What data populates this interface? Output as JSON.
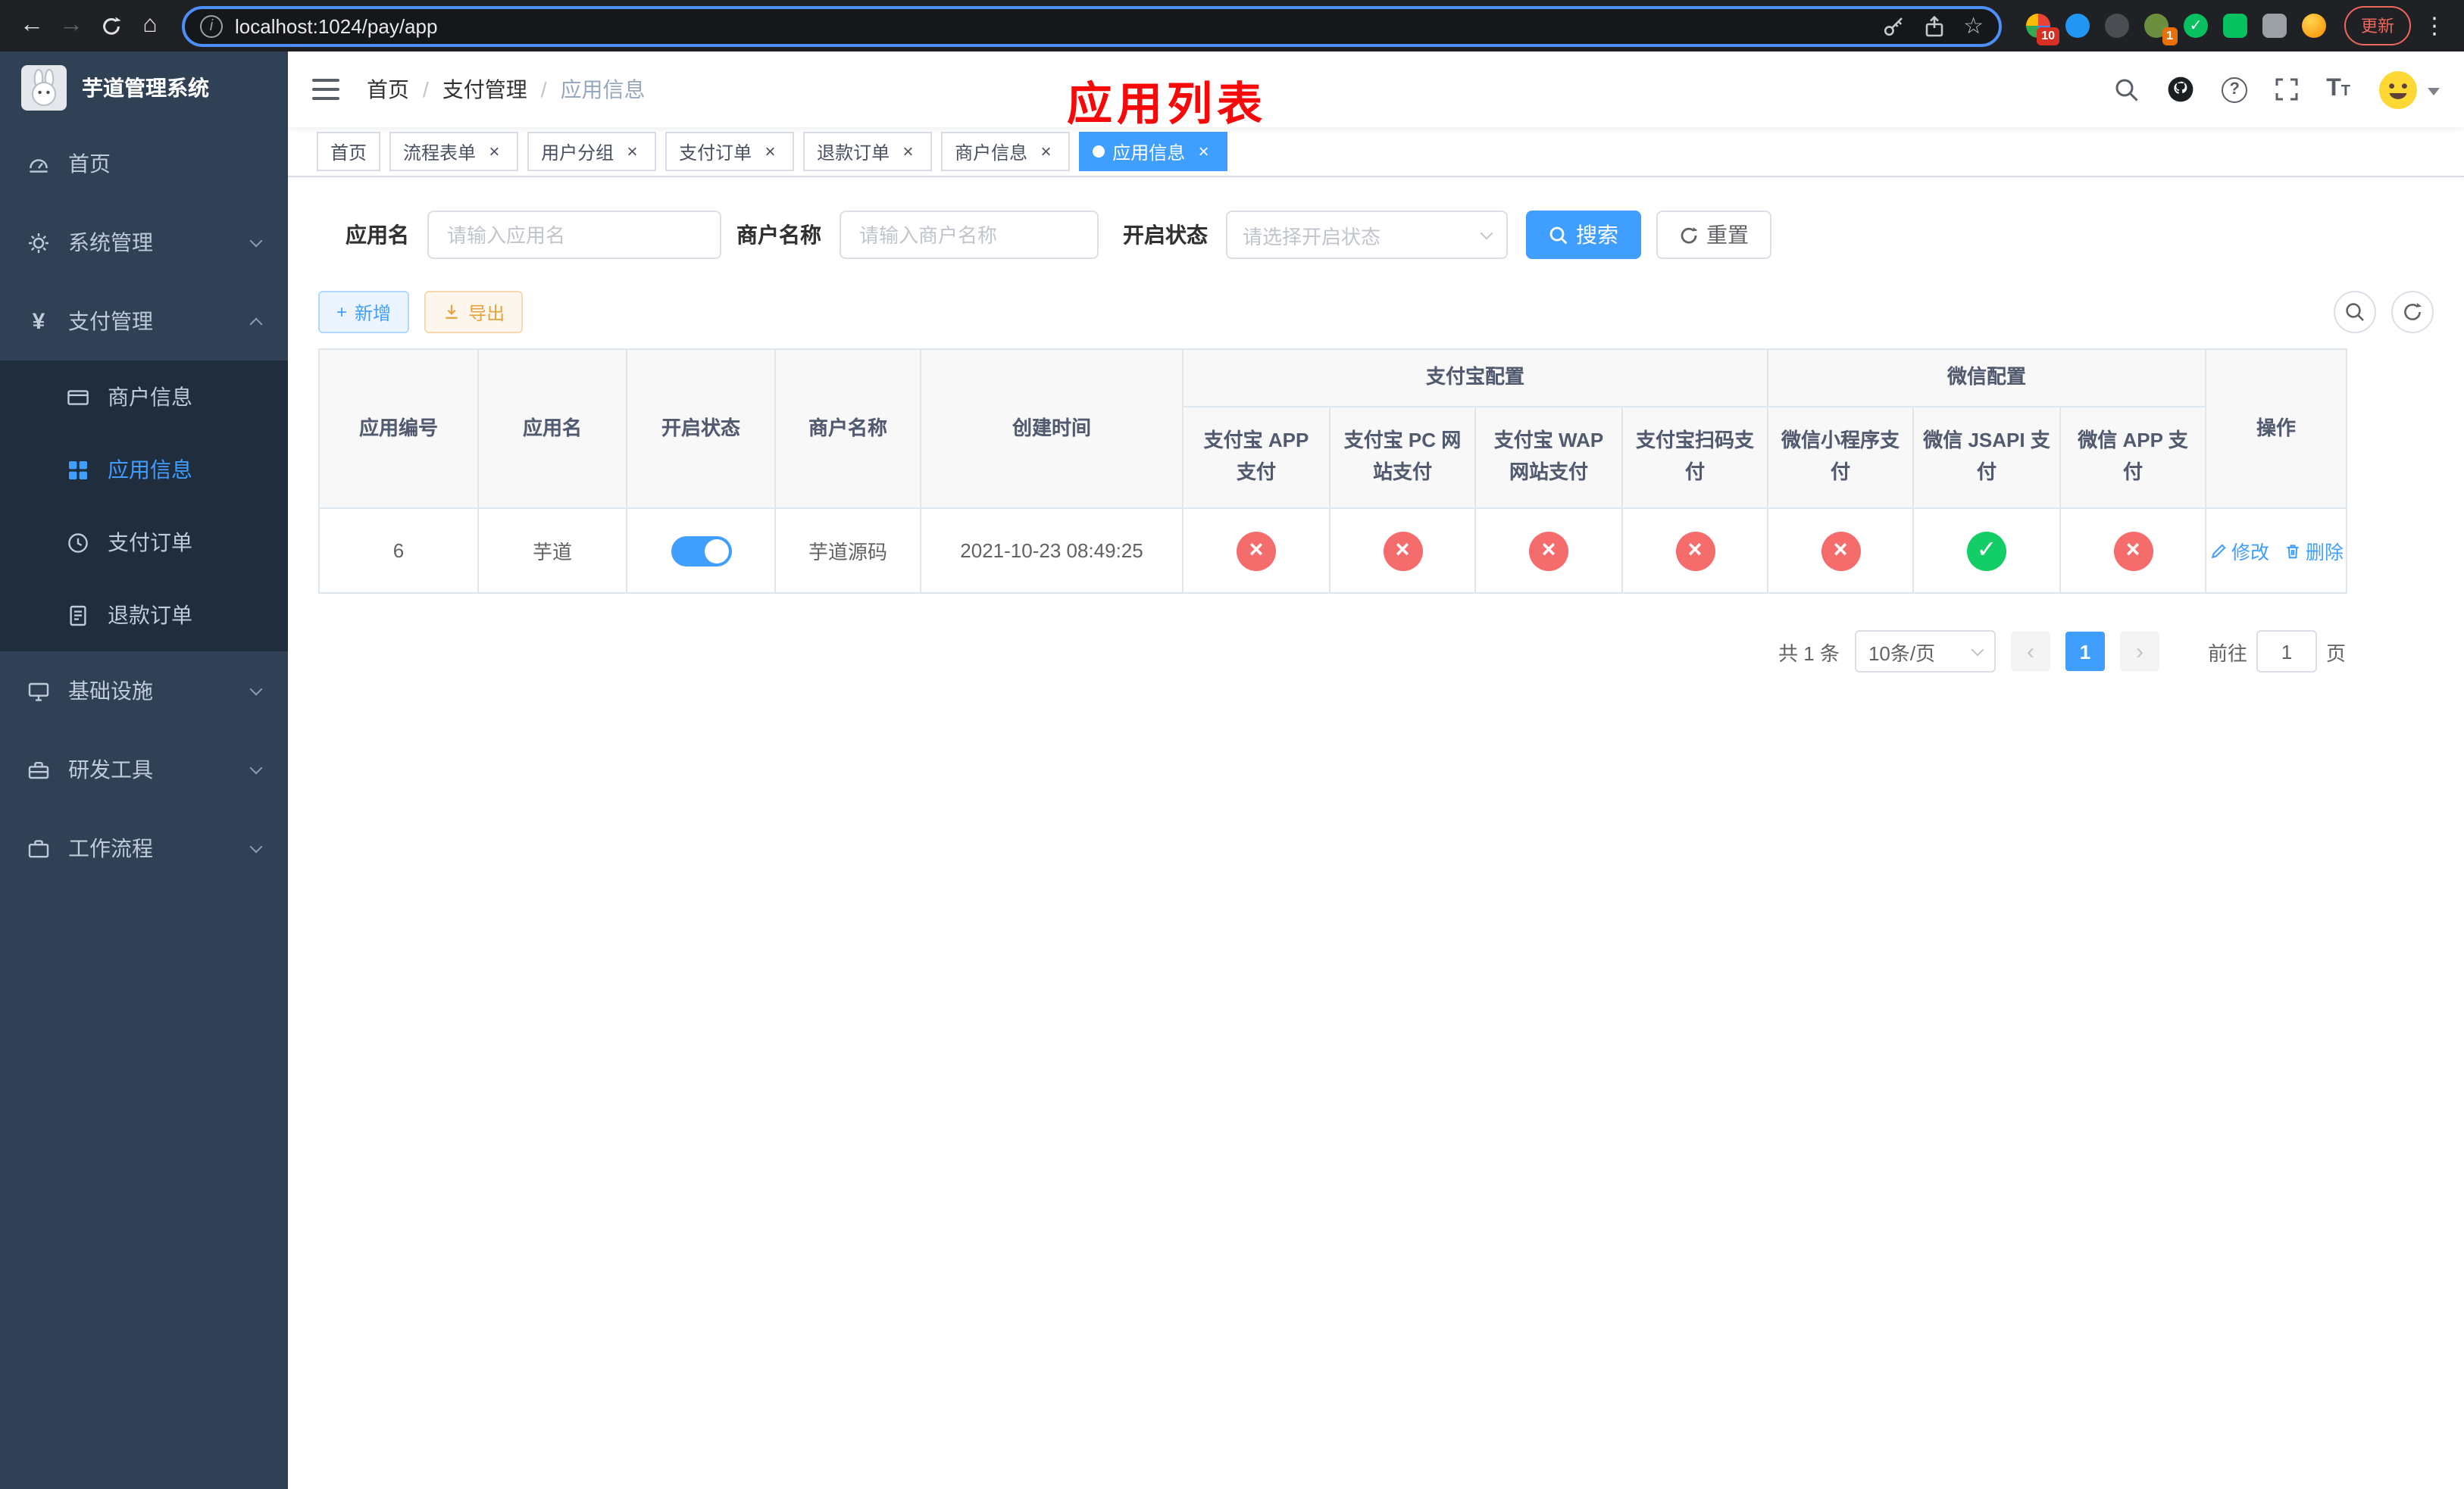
{
  "browser": {
    "url": "localhost:1024/pay/app",
    "update_label": "更新",
    "ext_badge_count": "10",
    "avatar_badge_count": "1"
  },
  "icons": {
    "back": "←",
    "forward": "→",
    "home": "⌂",
    "info": "i",
    "star": "☆",
    "menu_dots": "⋮",
    "question": "?",
    "text_size": "T",
    "close": "×",
    "check": "✓",
    "cross": "×",
    "plus": "+",
    "prev": "‹",
    "next": "›",
    "yen": "¥"
  },
  "sidebar": {
    "title": "芋道管理系统",
    "items": [
      {
        "label": "首页"
      },
      {
        "label": "系统管理"
      },
      {
        "label": "支付管理",
        "expanded": true,
        "children": [
          {
            "label": "商户信息"
          },
          {
            "label": "应用信息",
            "active": true
          },
          {
            "label": "支付订单"
          },
          {
            "label": "退款订单"
          }
        ]
      },
      {
        "label": "基础设施"
      },
      {
        "label": "研发工具"
      },
      {
        "label": "工作流程"
      }
    ]
  },
  "header": {
    "breadcrumb": [
      "首页",
      "支付管理",
      "应用信息"
    ],
    "breadcrumb_separator": "/",
    "overlay_title": "应用列表"
  },
  "tabs": [
    {
      "label": "首页",
      "closable": false
    },
    {
      "label": "流程表单",
      "closable": true
    },
    {
      "label": "用户分组",
      "closable": true
    },
    {
      "label": "支付订单",
      "closable": true
    },
    {
      "label": "退款订单",
      "closable": true
    },
    {
      "label": "商户信息",
      "closable": true
    },
    {
      "label": "应用信息",
      "closable": true,
      "active": true
    }
  ],
  "filters": {
    "app_name_label": "应用名",
    "app_name_placeholder": "请输入应用名",
    "merchant_label": "商户名称",
    "merchant_placeholder": "请输入商户名称",
    "status_label": "开启状态",
    "status_placeholder": "请选择开启状态",
    "search_button": "搜索",
    "reset_button": "重置"
  },
  "toolbar": {
    "add_label": "新增",
    "export_label": "导出"
  },
  "table": {
    "columns": [
      "应用编号",
      "应用名",
      "开启状态",
      "商户名称",
      "创建时间"
    ],
    "groups": [
      {
        "label": "支付宝配置",
        "children": [
          "支付宝 APP 支付",
          "支付宝 PC 网站支付",
          "支付宝 WAP 网站支付",
          "支付宝扫码支付"
        ]
      },
      {
        "label": "微信配置",
        "children": [
          "微信小程序支付",
          "微信 JSAPI 支付",
          "微信 APP 支付"
        ]
      }
    ],
    "action_column": "操作",
    "rows": [
      {
        "id": "6",
        "name": "芋道",
        "enabled": true,
        "merchant": "芋道源码",
        "created": "2021-10-23 08:49:25",
        "statuses": [
          "cross",
          "cross",
          "cross",
          "cross",
          "cross",
          "check",
          "cross"
        ],
        "actions": [
          "修改",
          "删除"
        ]
      }
    ]
  },
  "pagination": {
    "total": "共 1 条",
    "page_size": "10条/页",
    "current_page": "1",
    "goto_label": "前往",
    "goto_value": "1",
    "goto_suffix": "页"
  },
  "colors": {
    "primary": "#409eff",
    "danger": "#f56c6c",
    "success": "#13ce66",
    "overlay_title": "#f70909",
    "sidebar_bg": "#304156",
    "submenu_bg": "#1f2d3d"
  }
}
